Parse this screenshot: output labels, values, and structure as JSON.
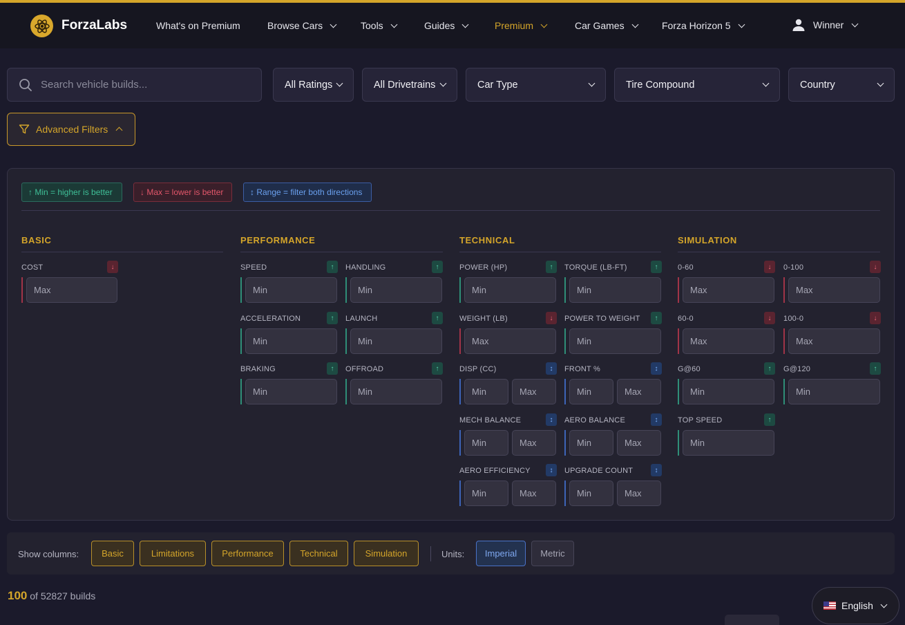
{
  "nav": {
    "brand": "ForzaLabs",
    "items": [
      {
        "label": "What's on Premium",
        "dropdown": false
      },
      {
        "label": "Browse Cars",
        "dropdown": true
      },
      {
        "label": "Tools",
        "dropdown": true
      },
      {
        "label": "Guides",
        "dropdown": true
      },
      {
        "label": "Premium",
        "dropdown": true
      },
      {
        "label": "Car Games",
        "dropdown": true
      },
      {
        "label": "Forza Horizon 5",
        "dropdown": true
      }
    ],
    "user": "Winner"
  },
  "search": {
    "placeholder": "Search vehicle builds..."
  },
  "filters": [
    "All Ratings",
    "All Drivetrains",
    "Car Type",
    "Tire Compound",
    "Country"
  ],
  "advanced_label": "Advanced Filters",
  "legend": {
    "min": "↑ Min = higher is better",
    "max": "↓ Max = lower is better",
    "range": "↕ Range = filter both directions"
  },
  "sections": {
    "basic": "BASIC",
    "performance": "PERFORMANCE",
    "technical": "TECHNICAL",
    "simulation": "SIMULATION"
  },
  "fields": {
    "cost": "COST",
    "speed": "SPEED",
    "handling": "HANDLING",
    "acceleration": "ACCELERATION",
    "launch": "LAUNCH",
    "braking": "BRAKING",
    "offroad": "OFFROAD",
    "power": "POWER (HP)",
    "torque": "TORQUE (LB-FT)",
    "weight": "WEIGHT (LB)",
    "ptw": "POWER TO WEIGHT",
    "disp": "DISP (CC)",
    "front": "FRONT %",
    "mech": "MECH BALANCE",
    "aero_bal": "AERO BALANCE",
    "aero_eff": "AERO EFFICIENCY",
    "upgrade": "UPGRADE COUNT",
    "z60": "0-60",
    "z100": "0-100",
    "s60": "60-0",
    "s100": "100-0",
    "g60": "G@60",
    "g120": "G@120",
    "top": "TOP SPEED"
  },
  "badges": {
    "min": "↑",
    "max": "↓",
    "range": "↕"
  },
  "placeholders": {
    "min": "Min",
    "max": "Max"
  },
  "show_columns_label": "Show columns:",
  "column_buttons": [
    "Basic",
    "Limitations",
    "Performance",
    "Technical",
    "Simulation"
  ],
  "units_label": "Units:",
  "units": [
    "Imperial",
    "Metric"
  ],
  "count": {
    "shown": "100",
    "rest": "of 52827 builds"
  },
  "language": "English",
  "colors": {
    "accent": "#d4a52a",
    "min": "#3fbf97",
    "max": "#e2566a",
    "range": "#6aa0ee"
  }
}
